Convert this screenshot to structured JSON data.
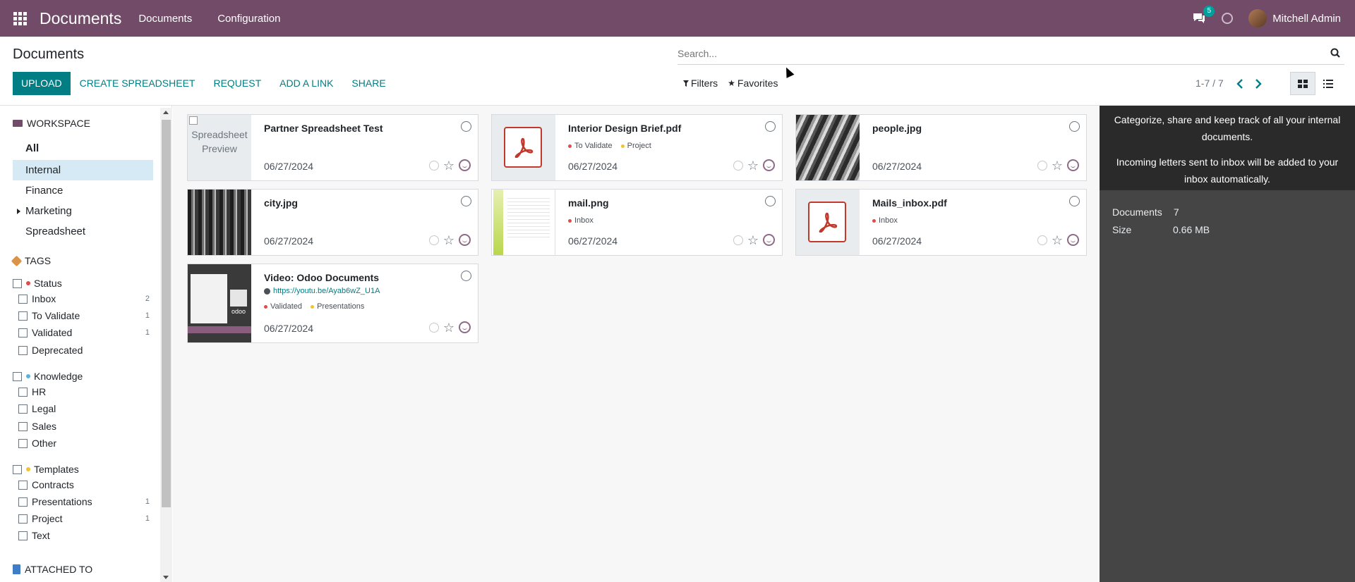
{
  "navbar": {
    "app_title": "Documents",
    "menus": [
      "Documents",
      "Configuration"
    ],
    "chat_badge": "5",
    "user_name": "Mitchell Admin"
  },
  "control_panel": {
    "breadcrumb": "Documents",
    "search_placeholder": "Search...",
    "buttons": {
      "upload": "UPLOAD",
      "create_spreadsheet": "CREATE SPREADSHEET",
      "request": "REQUEST",
      "add_link": "ADD A LINK",
      "share": "SHARE"
    },
    "filters_label": "Filters",
    "favorites_label": "Favorites",
    "pager": "1-7 / 7"
  },
  "sidebar": {
    "workspace_title": "WORKSPACE",
    "workspaces": [
      "All",
      "Internal",
      "Finance",
      "Marketing",
      "Spreadsheet"
    ],
    "tags_title": "TAGS",
    "tag_groups": [
      {
        "name": "Status",
        "color": "#e04b4b",
        "tags": [
          {
            "name": "Inbox",
            "count": "2"
          },
          {
            "name": "To Validate",
            "count": "1"
          },
          {
            "name": "Validated",
            "count": "1"
          },
          {
            "name": "Deprecated",
            "count": ""
          }
        ]
      },
      {
        "name": "Knowledge",
        "color": "#5ab4d6",
        "tags": [
          {
            "name": "HR",
            "count": ""
          },
          {
            "name": "Legal",
            "count": ""
          },
          {
            "name": "Sales",
            "count": ""
          },
          {
            "name": "Other",
            "count": ""
          }
        ]
      },
      {
        "name": "Templates",
        "color": "#f0c330",
        "tags": [
          {
            "name": "Contracts",
            "count": ""
          },
          {
            "name": "Presentations",
            "count": "1"
          },
          {
            "name": "Project",
            "count": "1"
          },
          {
            "name": "Text",
            "count": ""
          }
        ]
      }
    ],
    "attached_title": "ATTACHED TO"
  },
  "cards": [
    {
      "title": "Partner Spreadsheet Test",
      "date": "06/27/2024",
      "thumb": "spreadsheet",
      "preview_text": "Spreadsheet Preview",
      "tags": []
    },
    {
      "title": "Interior Design Brief.pdf",
      "date": "06/27/2024",
      "thumb": "pdf",
      "tags": [
        {
          "name": "To Validate",
          "color": "#e04b4b"
        },
        {
          "name": "Project",
          "color": "#f0c330"
        }
      ]
    },
    {
      "title": "people.jpg",
      "date": "06/27/2024",
      "thumb": "photo",
      "tags": []
    },
    {
      "title": "city.jpg",
      "date": "06/27/2024",
      "thumb": "photo-dark",
      "tags": []
    },
    {
      "title": "mail.png",
      "date": "06/27/2024",
      "thumb": "mail",
      "tags": [
        {
          "name": "Inbox",
          "color": "#e04b4b"
        }
      ]
    },
    {
      "title": "Mails_inbox.pdf",
      "date": "06/27/2024",
      "thumb": "pdf",
      "tags": [
        {
          "name": "Inbox",
          "color": "#e04b4b"
        }
      ]
    },
    {
      "title": "Video: Odoo Documents",
      "date": "06/27/2024",
      "thumb": "video",
      "url": "https://youtu.be/Ayab6wZ_U1A",
      "tags": [
        {
          "name": "Validated",
          "color": "#e04b4b"
        },
        {
          "name": "Presentations",
          "color": "#f0c330"
        }
      ]
    }
  ],
  "info_panel": {
    "line1": "Categorize, share and keep track of all your internal documents.",
    "line2": "Incoming letters sent to inbox will be added to your inbox automatically.",
    "documents_label": "Documents",
    "documents_value": "7",
    "size_label": "Size",
    "size_value": "0.66 MB"
  },
  "colors": {
    "brand": "#714b67",
    "accent": "#017e84",
    "active_workspace": "#d6eaf5"
  },
  "icons": [
    "apps-icon",
    "chat-icon",
    "clock-icon",
    "search-icon",
    "filter-icon",
    "star-icon",
    "chevron-left-icon",
    "chevron-right-icon",
    "kanban-view-icon",
    "list-view-icon",
    "folder-icon",
    "tag-icon",
    "document-icon",
    "pdf-icon",
    "globe-icon"
  ]
}
